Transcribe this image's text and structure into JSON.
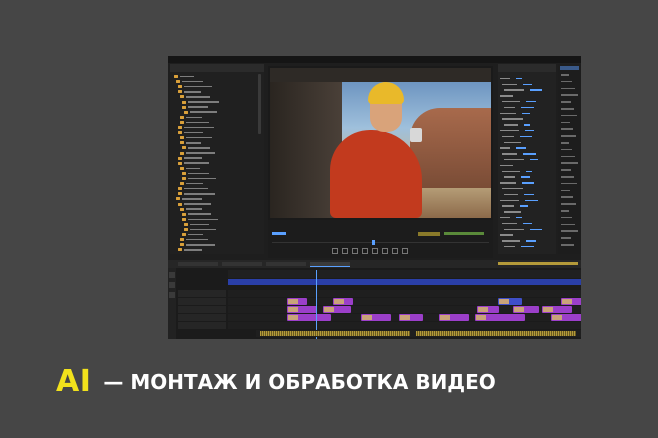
{
  "caption": {
    "badge": "AI",
    "text": "— МОНТАЖ И ОБРАБОТКА ВИДЕО"
  },
  "colors": {
    "background": "#464646",
    "badge": "#f2e21c",
    "accent_blue": "#5aa0ff",
    "clip_purple": "#9b3fc9",
    "clip_blue": "#3f4fc9",
    "audio_gold": "#b49a3a"
  },
  "icons": [
    "folder-icon",
    "play-icon",
    "step-back-icon",
    "step-forward-icon",
    "razor-icon",
    "selection-icon"
  ]
}
